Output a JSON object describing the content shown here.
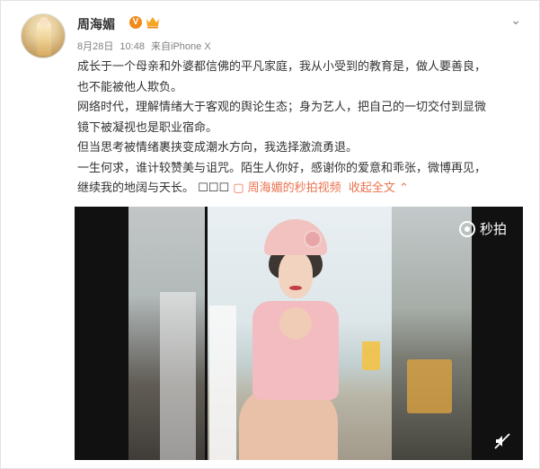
{
  "user": {
    "name": "周海媚",
    "verified_badge": "V"
  },
  "meta": {
    "date": "8月28日",
    "time": "10:48",
    "source_prefix": "来自",
    "source": "iPhone X"
  },
  "post": {
    "lines": [
      "成长于一个母亲和外婆都信佛的平凡家庭，我从小受到的教育是，做人要善良，",
      "也不能被他人欺负。",
      "网络时代，理解情绪大于客观的舆论生态；身为艺人，把自己的一切交付到显微",
      "镜下被凝视也是职业宿命。",
      "但当思考被情绪裹挟变成潮水方向，我选择激流勇退。",
      "一生何求，谁计较赞美与诅咒。陌生人你好，感谢你的爱意和乖张，微博再见，"
    ],
    "last_line_prefix": "继续我的地阔与天长。",
    "emoji_text": "☐☐☐",
    "video_link": "▢ 周海媚的秒拍视频",
    "expand_text": "收起全文 ⌃"
  },
  "video": {
    "brand": "秒拍"
  },
  "colors": {
    "link": "#eb7350",
    "badge": "#f08a1c"
  }
}
